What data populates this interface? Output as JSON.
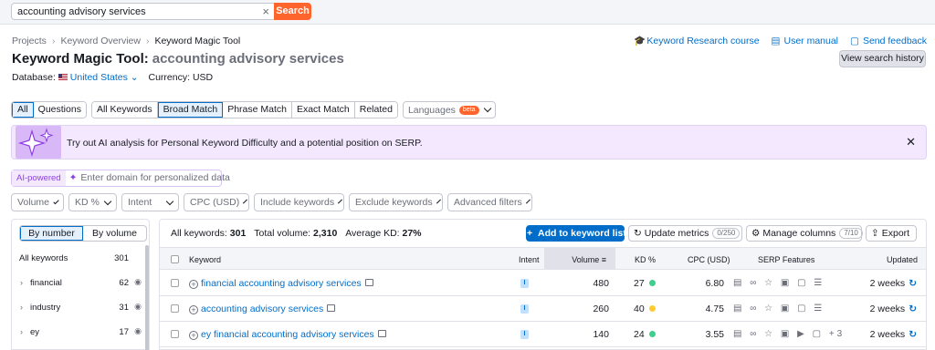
{
  "search": {
    "value": "accounting advisory services",
    "clear_icon": "close-icon",
    "button_label": "Search"
  },
  "breadcrumb": {
    "items": [
      "Projects",
      "Keyword Overview",
      "Keyword Magic Tool"
    ]
  },
  "header_links": {
    "course": "Keyword Research course",
    "manual": "User manual",
    "feedback": "Send feedback"
  },
  "title": {
    "tool": "Keyword Magic Tool:",
    "keyword": "accounting advisory services"
  },
  "history_button": "View search history",
  "database": {
    "label": "Database:",
    "value": "United States",
    "currency_label": "Currency:",
    "currency_value": "USD"
  },
  "tabs": {
    "group1": [
      "All",
      "Questions"
    ],
    "group2": [
      "All Keywords",
      "Broad Match",
      "Phrase Match",
      "Exact Match",
      "Related"
    ],
    "languages": "Languages",
    "beta": "beta",
    "active_group1": "All",
    "active_group2": "Broad Match"
  },
  "banner": {
    "prefix": "Try out ",
    "highlight": "AI analysis",
    "suffix": " for Personal Keyword Difficulty and a potential position on SERP."
  },
  "ai_row": {
    "label": "AI-powered",
    "placeholder": "Enter domain for personalized data"
  },
  "filters": [
    "Volume",
    "KD %",
    "Intent",
    "CPC (USD)",
    "Include keywords",
    "Exclude keywords",
    "Advanced filters"
  ],
  "left_panel": {
    "seg_by_number": "By number",
    "seg_by_volume": "By volume",
    "header_label": "All keywords",
    "header_count": "301",
    "groups": [
      {
        "label": "financial",
        "count": "62"
      },
      {
        "label": "industry",
        "count": "31"
      },
      {
        "label": "ey",
        "count": "17"
      }
    ]
  },
  "summary": {
    "all_keywords_label": "All keywords:",
    "all_keywords_value": "301",
    "total_volume_label": "Total volume:",
    "total_volume_value": "2,310",
    "avg_kd_label": "Average KD:",
    "avg_kd_value": "27%"
  },
  "toolbar": {
    "add_label": "Add to keyword list",
    "update_label": "Update metrics",
    "update_count": "0/250",
    "columns_label": "Manage columns",
    "columns_count": "7/10",
    "export_label": "Export"
  },
  "table": {
    "headers": {
      "keyword": "Keyword",
      "intent": "Intent",
      "volume": "Volume",
      "kd": "KD %",
      "cpc": "CPC (USD)",
      "serp": "SERP Features",
      "updated": "Updated"
    },
    "rows": [
      {
        "keyword": "financial accounting advisory services",
        "intent": "I",
        "volume": "480",
        "kd": "27",
        "kd_color": "#3ecf8e",
        "cpc": "6.80",
        "serp_extra": "",
        "updated": "2 weeks"
      },
      {
        "keyword": "accounting advisory services",
        "intent": "I",
        "volume": "260",
        "kd": "40",
        "kd_color": "#ffcb2f",
        "cpc": "4.75",
        "serp_extra": "",
        "updated": "2 weeks"
      },
      {
        "keyword": "ey financial accounting advisory services",
        "intent": "I",
        "volume": "140",
        "kd": "24",
        "kd_color": "#3ecf8e",
        "cpc": "3.55",
        "serp_extra": "+3",
        "updated": "2 weeks"
      }
    ]
  },
  "colors": {
    "accent_orange": "#ff642d",
    "link_blue": "#006dca",
    "ai_purple": "#8d3ee4"
  }
}
